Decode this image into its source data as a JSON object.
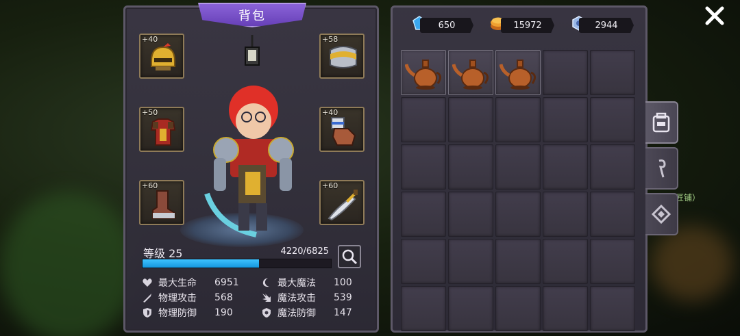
{
  "panel": {
    "title": "背包"
  },
  "equipment": [
    {
      "slot": "helmet",
      "bonus": "+40",
      "icon": "helmet-icon"
    },
    {
      "slot": "chest-armor",
      "bonus": "+50",
      "icon": "armor-icon"
    },
    {
      "slot": "boots",
      "bonus": "+60",
      "icon": "boots-icon"
    },
    {
      "slot": "shoulder",
      "bonus": "+58",
      "icon": "shoulder-icon"
    },
    {
      "slot": "gloves",
      "bonus": "+40",
      "icon": "gloves-icon"
    },
    {
      "slot": "weapon",
      "bonus": "+60",
      "icon": "sword-icon"
    }
  ],
  "level": {
    "label": "等级 25",
    "exp_text": "4220/6825",
    "exp_fraction": 0.618
  },
  "stats": {
    "max_hp": {
      "label": "最大生命",
      "value": "6951"
    },
    "phys_atk": {
      "label": "物理攻击",
      "value": "568"
    },
    "phys_def": {
      "label": "物理防御",
      "value": "190"
    },
    "max_mp": {
      "label": "最大魔法",
      "value": "100"
    },
    "magic_atk": {
      "label": "魔法攻击",
      "value": "539"
    },
    "magic_def": {
      "label": "魔法防御",
      "value": "147"
    }
  },
  "currencies": {
    "gems": "650",
    "gold": "15972",
    "crystal": "2944"
  },
  "inventory": {
    "columns": 5,
    "items": [
      "teapot",
      "teapot",
      "teapot"
    ],
    "total_visible_cells": 30
  },
  "side_tabs": [
    "backpack-tab-icon",
    "staff-tab-icon",
    "rune-tab-icon"
  ],
  "background": {
    "shop_hint": "匠铺）"
  },
  "colors": {
    "accent": "#7a55cc",
    "exp": "#2aaef0",
    "slot_border": "#8f7b58"
  }
}
